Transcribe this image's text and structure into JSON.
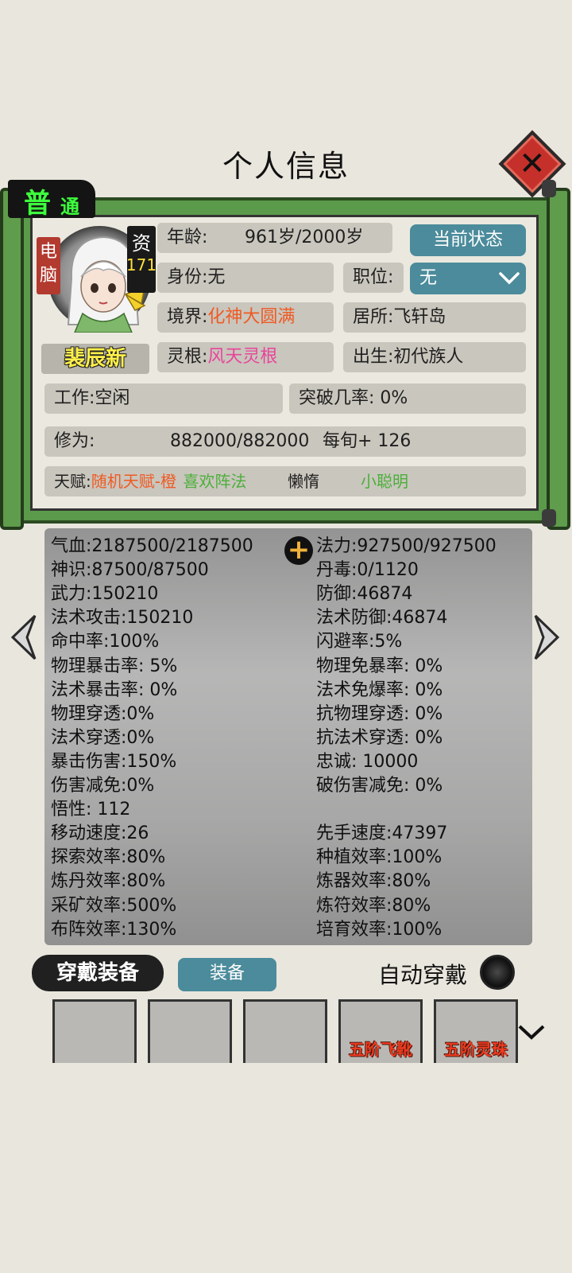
{
  "title": "个人信息",
  "rank": {
    "a": "普",
    "b": "通"
  },
  "avatar": {
    "tag_pc": "电脑",
    "tag_zi": "资",
    "zi_value": "171",
    "name": "裴辰新"
  },
  "info": {
    "age_label": "年龄:",
    "age_value": "961岁/2000岁",
    "status_button": "当前状态",
    "identity_label": "身份:",
    "identity_value": "无",
    "position_label": "职位:",
    "position_value": "无",
    "realm_label": "境界:",
    "realm_value": "化神大圆满",
    "residence_label": "居所:",
    "residence_value": "飞轩岛",
    "root_label": "灵根:",
    "root_value": "风天灵根",
    "birth_label": "出生:",
    "birth_value": "初代族人",
    "work_label": "工作:",
    "work_value": "空闲",
    "breakthrough_label": "突破几率:",
    "breakthrough_value": "0%",
    "cultivation_label": "修为:",
    "cultivation_value": "882000/882000",
    "per_turn": "每旬+ 126",
    "talent_label": "天赋:",
    "talents": [
      "随机天赋-橙",
      "喜欢阵法",
      "懒惰",
      "小聪明"
    ]
  },
  "stats_left": [
    "气血:2187500/2187500",
    "神识:87500/87500",
    "武力:150210",
    "法术攻击:150210",
    "命中率:100%",
    "物理暴击率: 5%",
    "法术暴击率: 0%",
    "物理穿透:0%",
    "法术穿透:0%",
    "暴击伤害:150%",
    "伤害减免:0%",
    "悟性: 112",
    "移动速度:26",
    "探索效率:80%",
    "炼丹效率:80%",
    "采矿效率:500%",
    "布阵效率:130%"
  ],
  "stats_right": [
    "法力:927500/927500",
    "丹毒:0/1120",
    "防御:46874",
    "法术防御:46874",
    "闪避率:5%",
    "物理免暴率: 0%",
    "法术免爆率: 0%",
    "抗物理穿透: 0%",
    "抗法术穿透: 0%",
    "忠诚: 10000",
    "破伤害减免: 0%",
    "",
    "先手速度:47397",
    "种植效率:100%",
    "炼器效率:80%",
    "炼符效率:80%",
    "培育效率:100%"
  ],
  "equipment": {
    "label": "穿戴装备",
    "button": "装备",
    "auto_label": "自动穿戴",
    "slots": [
      "",
      "",
      "",
      "五阶飞靴",
      "五阶灵珠"
    ]
  },
  "colors": {
    "frame_green": "#5a9a4a",
    "teal_button": "#4b8b9b",
    "orange_text": "#ef5a24",
    "pink_text": "#e8449a",
    "green_text": "#4caf3b"
  }
}
